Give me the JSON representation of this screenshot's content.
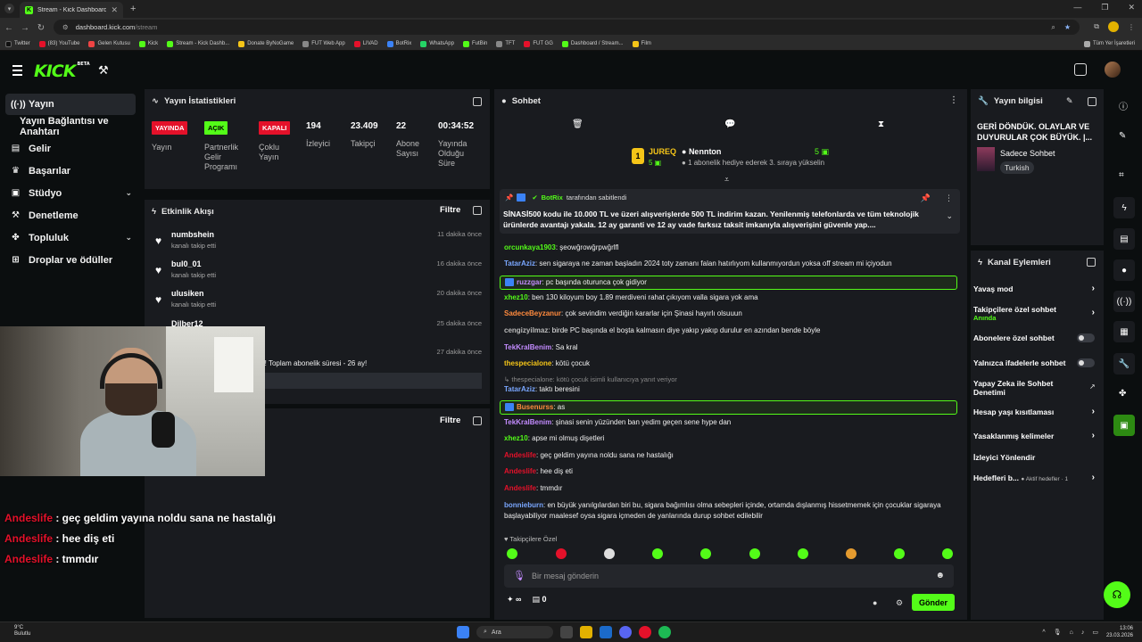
{
  "browser": {
    "tab_title": "Stream - Kick Dashboard",
    "url_host": "dashboard.kick.com",
    "url_path": "/stream",
    "bookmarks": [
      "Twitter",
      "(83) YouTube",
      "Gelen Kutusu",
      "Kick",
      "Stream - Kick Dashb...",
      "Donate ByNoGame",
      "FUT Web App",
      "LIVAD",
      "BotRix",
      "WhatsApp",
      "FutBin",
      "TFT",
      "FUT GG",
      "Dashboard / Stream...",
      "Film"
    ],
    "all_bookmarks": "Tüm Yer İşaretleri"
  },
  "header": {
    "logo": "KICK",
    "logo_badge": "BETA"
  },
  "nav": {
    "items": [
      {
        "label": "Yayın",
        "icon": "radio"
      },
      {
        "label": "Yayın Bağlantısı ve Anahtarı",
        "icon": ""
      },
      {
        "label": "Gelir",
        "icon": "chart"
      },
      {
        "label": "Başarılar",
        "icon": "trophy"
      },
      {
        "label": "Stüdyo",
        "icon": "studio"
      },
      {
        "label": "Denetleme",
        "icon": "hammer"
      },
      {
        "label": "Topluluk",
        "icon": "community"
      },
      {
        "label": "Droplar ve ödüller",
        "icon": "gift"
      }
    ]
  },
  "stats": {
    "title": "Yayın İstatistikleri",
    "badges": [
      {
        "text": "YAYINDA",
        "label": "Yayın",
        "color": "#e4112a"
      },
      {
        "text": "AÇIK",
        "label": "Partnerlik Gelir Programı",
        "color": "#53fc18"
      },
      {
        "text": "KAPALI",
        "label": "Çoklu Yayın",
        "color": "#e4112a"
      }
    ],
    "numbers": [
      {
        "value": "194",
        "label": "İzleyici"
      },
      {
        "value": "23.409",
        "label": "Takipçi"
      },
      {
        "value": "22",
        "label": "Abone Sayısı"
      },
      {
        "value": "00:34:52",
        "label": "Yayında Olduğu Süre"
      }
    ]
  },
  "activity": {
    "title": "Etkinlik Akışı",
    "filter": "Filtre",
    "items": [
      {
        "name": "numbshein",
        "sub": "kanalı takip etti",
        "time": "11 dakika önce"
      },
      {
        "name": "bul0_01",
        "sub": "kanalı takip etti",
        "time": "16 dakika önce"
      },
      {
        "name": "ulusiken",
        "sub": "kanalı takip etti",
        "time": "20 dakika önce"
      },
      {
        "name": "Dilber12",
        "sub": "",
        "time": "25 dakika önce"
      },
      {
        "name": "",
        "sub": "r! Toplam abonelik süresi - 26 ay!",
        "time": "27 dakika önce"
      }
    ],
    "sub_months": "26"
  },
  "panel3": {
    "filter": "Filtre"
  },
  "overlay_chat": [
    {
      "user": "Andeslife",
      "text": " : geç geldim yayına noldu sana ne hastalığı"
    },
    {
      "user": "Andeslife",
      "text": " : hee diş eti"
    },
    {
      "user": "Andeslife",
      "text": " : tmmdır"
    }
  ],
  "chat": {
    "title": "Sohbet",
    "gifter_1": {
      "name": "JUREQ",
      "count": "5"
    },
    "gifter_2": {
      "name": "Nennton",
      "count": "5",
      "sub": "1 abonelik hediye ederek 3. sıraya yükselin"
    },
    "pinned": {
      "header": "tarafından sabitlendi",
      "by": "BotRix",
      "text": "SİNASİ500 kodu ile 10.000 TL ve üzeri alışverişlerde 500 TL indirim kazan.  Yenilenmiş telefonlarda ve tüm teknolojik ürünlerde avantajı yakala. 12 ay garanti ve 12 ay vade farksız taksit imkanıyla alışverişini güvenle yap...."
    },
    "messages": [
      {
        "user": "orcunkaya1903",
        "color": "#53fc18",
        "text": ": şeowğrowğrpwğrlfl",
        "hl": false,
        "mod": false
      },
      {
        "user": "TatarAziz",
        "color": "#7aa7ff",
        "text": ": sen sigaraya ne zaman başladın 2024 toty zamanı falan hatırlıyom kullanmıyordun yoksa off stream mi içiyodun",
        "hl": false,
        "mod": false
      },
      {
        "user": "ruzzgar",
        "color": "#c38bff",
        "text": ": pc başında oturunca çok gidiyor",
        "hl": true,
        "mod": true
      },
      {
        "user": "xhez10",
        "color": "#53fc18",
        "text": ": ben 130 kiloyum boy 1.89 merdiveni rahat çıkıyom valla sigara yok ama",
        "hl": false,
        "mod": false
      },
      {
        "user": "SadeceBeyzanur",
        "color": "#ff8a3d",
        "text": ": çok sevindim verdiğin kararlar için Şinasi hayırlı olsuuun",
        "hl": false,
        "mod": false
      },
      {
        "user": "cengizyilmaz",
        "color": "#bbbbbb",
        "text": ": birde PC başında el boşta kalmasın diye yakıp yakıp durulur en azından bende böyle",
        "hl": false,
        "mod": false
      },
      {
        "user": "TekKralBenim",
        "color": "#c38bff",
        "text": ": Sa kral",
        "hl": false,
        "mod": false
      },
      {
        "user": "thespecialone",
        "color": "#f5c518",
        "text": ": kötü çocuk",
        "hl": false,
        "mod": false
      },
      {
        "user": "",
        "color": "#888888",
        "text": "↳ thespecialone: kötü çocuk isimli kullanıcıya yanıt veriyor",
        "hl": false,
        "mod": false,
        "reply": true
      },
      {
        "user": "TatarAziz",
        "color": "#7aa7ff",
        "text": ": taktı beresini",
        "hl": false,
        "mod": false
      },
      {
        "user": "Busenurss",
        "color": "#ff8a3d",
        "text": ": as",
        "hl": true,
        "mod": true
      },
      {
        "user": "TekKralBenim",
        "color": "#c38bff",
        "text": ": şinasi senin yüzünden ban yedim geçen sene hype dan",
        "hl": false,
        "mod": false
      },
      {
        "user": "xhez10",
        "color": "#53fc18",
        "text": ": apse mi olmuş dişetleri",
        "hl": false,
        "mod": false
      },
      {
        "user": "Andeslife",
        "color": "#e4112a",
        "text": ": geç geldim yayına noldu sana ne hastalığı",
        "hl": false,
        "mod": false
      },
      {
        "user": "Andeslife",
        "color": "#e4112a",
        "text": ": hee diş eti",
        "hl": false,
        "mod": false
      },
      {
        "user": "Andeslife",
        "color": "#e4112a",
        "text": ": tmmdır",
        "hl": false,
        "mod": false
      },
      {
        "user": "bonnieburn",
        "color": "#7aa7ff",
        "text": ": en büyük yanılgılardan biri bu, sigara bağımlısı olma sebepleri içinde, ortamda dışlanmış hissetmemek için çocuklar sigaraya başlayabiliyor maalesef oysa sigara içmeden de yanlarında durup sohbet edilebilir",
        "hl": false,
        "mod": false
      }
    ],
    "followers_only": "Takipçilere Özel",
    "input_placeholder": "Bir mesaj gönderin",
    "points": "∞",
    "coins": "0",
    "send": "Gönder"
  },
  "info": {
    "title": "Yayın bilgisi",
    "stream_title": "GERİ DÖNDÜK. OLAYLAR VE DUYURULAR ÇOK BÜYÜK. |...",
    "category": "Sadece Sohbet",
    "language": "Turkish"
  },
  "channel_actions": {
    "title": "Kanal Eylemleri",
    "items": [
      {
        "label": "Yavaş mod",
        "sub": "",
        "kind": "chevron"
      },
      {
        "label": "Takipçilere özel sohbet",
        "sub": "Anında",
        "kind": "chevron"
      },
      {
        "label": "Abonelere özel sohbet",
        "sub": "",
        "kind": "toggle"
      },
      {
        "label": "Yalnızca ifadelerle sohbet",
        "sub": "",
        "kind": "toggle"
      },
      {
        "label": "Yapay Zeka ile Sohbet Denetimi",
        "sub": "",
        "kind": "external"
      },
      {
        "label": "Hesap yaşı kısıtlaması",
        "sub": "",
        "kind": "chevron"
      },
      {
        "label": "Yasaklanmış kelimeler",
        "sub": "",
        "kind": "chevron"
      },
      {
        "label": "İzleyici Yönlendir",
        "sub": "",
        "kind": "none"
      },
      {
        "label": "Hedefleri b...",
        "sub": "",
        "kind": "chevron",
        "mini": "Aktif hedefler · 1"
      }
    ]
  },
  "taskbar": {
    "weather_temp": "9°C",
    "weather_desc": "Bulutlu",
    "search": "Ara",
    "time": "13:06",
    "date": "23.03.2026"
  }
}
